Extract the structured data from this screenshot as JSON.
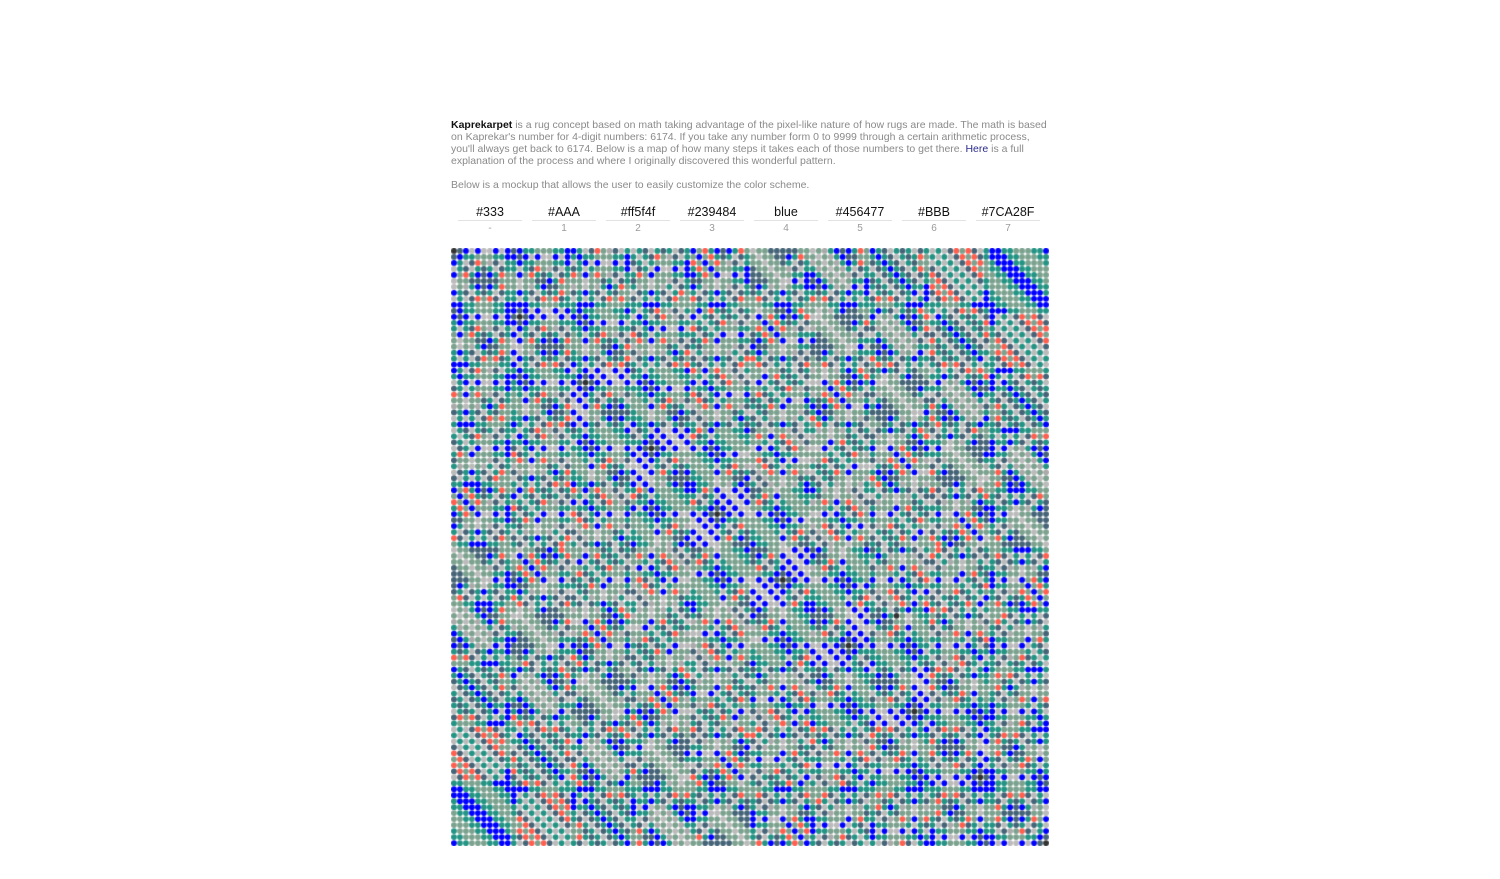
{
  "intro": {
    "brand": "Kaprekarpet",
    "text_before_link": " is a rug concept based on math taking advantage of the pixel-like nature of how rugs are made. The math is based on Kaprekar's number for 4-digit numbers: 6174. If you take any number form 0 to 9999 through a certain arithmetic process, you'll always get back to 6174. Below is a map of how many steps it takes each of those numbers to get there. ",
    "link_text": "Here",
    "text_after_link": " is a full explanation of the process and where I originally discovered this wonderful pattern."
  },
  "note": "Below is a mockup that allows the user to easily customize the color scheme.",
  "swatches": [
    {
      "value": "#333",
      "index": "-",
      "color": "#333333"
    },
    {
      "value": "#AAA",
      "index": "1",
      "color": "#AAAAAA"
    },
    {
      "value": "#ff5f4f",
      "index": "2",
      "color": "#ff5f4f"
    },
    {
      "value": "#239484",
      "index": "3",
      "color": "#239484"
    },
    {
      "value": "blue",
      "index": "4",
      "color": "#0000ff"
    },
    {
      "value": "#456477",
      "index": "5",
      "color": "#456477"
    },
    {
      "value": "#BBB",
      "index": "6",
      "color": "#BBBBBB"
    },
    {
      "value": "#7CA28F",
      "index": "7",
      "color": "#7CA28F"
    }
  ]
}
